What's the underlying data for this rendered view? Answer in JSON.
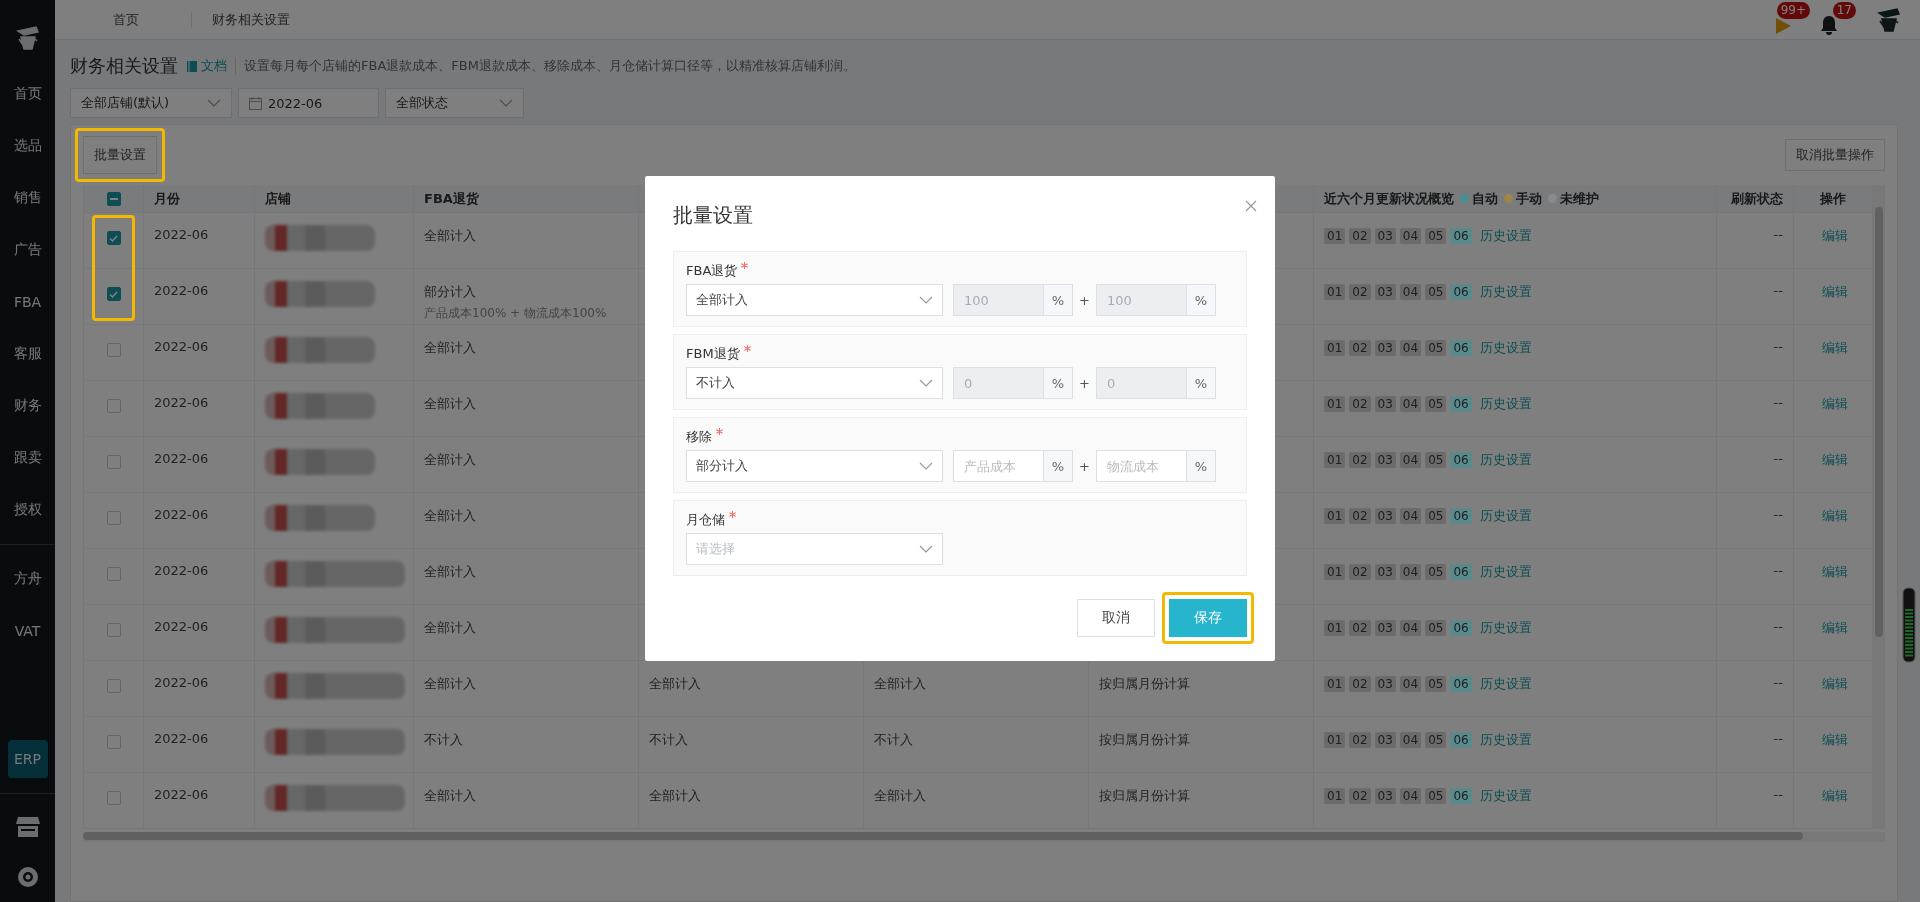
{
  "sidebar": {
    "items": [
      {
        "kind": "text",
        "label": "首页",
        "selected": false
      },
      {
        "kind": "text",
        "label": "选品",
        "selected": false
      },
      {
        "kind": "text",
        "label": "销售",
        "selected": false
      },
      {
        "kind": "text",
        "label": "广告",
        "selected": false
      },
      {
        "kind": "text",
        "label": "FBA",
        "selected": false
      },
      {
        "kind": "text",
        "label": "客服",
        "selected": false
      },
      {
        "kind": "text",
        "label": "财务",
        "selected": false
      },
      {
        "kind": "text",
        "label": "跟卖",
        "selected": false
      },
      {
        "kind": "text",
        "label": "授权",
        "selected": false
      },
      {
        "kind": "divider"
      },
      {
        "kind": "text",
        "label": "方舟",
        "selected": false
      },
      {
        "kind": "text",
        "label": "VAT",
        "selected": false
      },
      {
        "kind": "spacer"
      },
      {
        "kind": "text",
        "label": "ERP",
        "selected": true
      },
      {
        "kind": "divider"
      },
      {
        "kind": "store"
      },
      {
        "kind": "support"
      }
    ]
  },
  "topbar": {
    "tabs": [
      "首页",
      "财务相关设置"
    ],
    "notifications": [
      {
        "kind": "flag",
        "badge": "99+"
      },
      {
        "kind": "bell",
        "badge": "17"
      }
    ]
  },
  "page": {
    "title": "财务相关设置",
    "doc_link": "文档",
    "description": "设置每月每个店铺的FBA退款成本、FBM退款成本、移除成本、月仓储计算口径等，以精准核算店铺利润。"
  },
  "filters": [
    {
      "kind": "select",
      "value": "全部店铺(默认)"
    },
    {
      "kind": "date",
      "value": "2022-06"
    },
    {
      "kind": "select",
      "value": "全部状态"
    }
  ],
  "toolbar": {
    "batch_button": {
      "label": "批量设置",
      "highlighted": true
    },
    "cancel_batch_button": "取消批量操作"
  },
  "table": {
    "header_checkbox": {
      "indeterminate": true
    },
    "columns": {
      "month": "月份",
      "store": "店铺",
      "fba": "FBA退货",
      "overview": "近六个月更新状况概览",
      "refresh": "刷新状态",
      "action": "操作"
    },
    "legend": [
      {
        "label": "自动",
        "color": "#4a8e90"
      },
      {
        "label": "手动",
        "color": "#a08448"
      },
      {
        "label": "未维护",
        "color": "#8a8a8a"
      }
    ],
    "rows": [
      {
        "checked": true,
        "highlighted": true,
        "month": "2022-06",
        "fba": "全部计入",
        "months": [
          {
            "label": "01",
            "color": "#6b6b6b"
          },
          {
            "label": "02",
            "color": "#6b6b6b"
          },
          {
            "label": "03",
            "color": "#6b6b6b"
          },
          {
            "label": "04",
            "color": "#6b6b6b"
          },
          {
            "label": "05",
            "color": "#6b6b6b"
          },
          {
            "label": "06",
            "color": "#5a8a8c"
          }
        ],
        "history": "历史设置",
        "refresh": "--",
        "action": "编辑"
      },
      {
        "checked": true,
        "highlighted": true,
        "month": "2022-06",
        "fba": "部分计入",
        "fba_note": "产品成本100% + 物流成本100%",
        "months": [
          {
            "label": "01",
            "color": "#6b6b6b"
          },
          {
            "label": "02",
            "color": "#6b6b6b"
          },
          {
            "label": "03",
            "color": "#6b6b6b"
          },
          {
            "label": "04",
            "color": "#6b6b6b"
          },
          {
            "label": "05",
            "color": "#6b6b6b"
          },
          {
            "label": "06",
            "color": "#5a8a8c"
          }
        ],
        "history": "历史设置",
        "refresh": "--",
        "action": "编辑"
      },
      {
        "checked": false,
        "highlighted": false,
        "month": "2022-06",
        "fba": "全部计入",
        "months": [
          {
            "label": "01",
            "color": "#6b6b6b"
          },
          {
            "label": "02",
            "color": "#6b6b6b"
          },
          {
            "label": "03",
            "color": "#6b6b6b"
          },
          {
            "label": "04",
            "color": "#6b6b6b"
          },
          {
            "label": "05",
            "color": "#6b6b6b"
          },
          {
            "label": "06",
            "color": "#5a8a8c"
          }
        ],
        "history": "历史设置",
        "refresh": "--",
        "action": "编辑"
      },
      {
        "checked": false,
        "highlighted": false,
        "month": "2022-06",
        "fba": "全部计入",
        "months": [
          {
            "label": "01",
            "color": "#6b6b6b"
          },
          {
            "label": "02",
            "color": "#6b6b6b"
          },
          {
            "label": "03",
            "color": "#6b6b6b"
          },
          {
            "label": "04",
            "color": "#6b6b6b"
          },
          {
            "label": "05",
            "color": "#6b6b6b"
          },
          {
            "label": "06",
            "color": "#5a8a8c"
          }
        ],
        "history": "历史设置",
        "refresh": "--",
        "action": "编辑"
      },
      {
        "checked": false,
        "highlighted": false,
        "month": "2022-06",
        "fba": "全部计入",
        "months": [
          {
            "label": "01",
            "color": "#6b6b6b"
          },
          {
            "label": "02",
            "color": "#6b6b6b"
          },
          {
            "label": "03",
            "color": "#6b6b6b"
          },
          {
            "label": "04",
            "color": "#6b6b6b"
          },
          {
            "label": "05",
            "color": "#6b6b6b"
          },
          {
            "label": "06",
            "color": "#5a8a8c"
          }
        ],
        "history": "历史设置",
        "refresh": "--",
        "action": "编辑"
      },
      {
        "checked": false,
        "highlighted": false,
        "month": "2022-06",
        "fba": "全部计入",
        "months": [
          {
            "label": "01",
            "color": "#6b6b6b"
          },
          {
            "label": "02",
            "color": "#6b6b6b"
          },
          {
            "label": "03",
            "color": "#6b6b6b"
          },
          {
            "label": "04",
            "color": "#6b6b6b"
          },
          {
            "label": "05",
            "color": "#6b6b6b"
          },
          {
            "label": "06",
            "color": "#5a8a8c"
          }
        ],
        "history": "历史设置",
        "refresh": "--",
        "action": "编辑"
      },
      {
        "checked": false,
        "highlighted": false,
        "month": "2022-06",
        "fba": "全部计入",
        "months": [
          {
            "label": "01",
            "color": "#6b6b6b"
          },
          {
            "label": "02",
            "color": "#6b6b6b"
          },
          {
            "label": "03",
            "color": "#6b6b6b"
          },
          {
            "label": "04",
            "color": "#6b6b6b"
          },
          {
            "label": "05",
            "color": "#6b6b6b"
          },
          {
            "label": "06",
            "color": "#5a8a8c"
          }
        ],
        "history": "历史设置",
        "refresh": "--",
        "action": "编辑"
      },
      {
        "checked": false,
        "highlighted": false,
        "month": "2022-06",
        "fba": "全部计入",
        "months": [
          {
            "label": "01",
            "color": "#6b6b6b"
          },
          {
            "label": "02",
            "color": "#6b6b6b"
          },
          {
            "label": "03",
            "color": "#6b6b6b"
          },
          {
            "label": "04",
            "color": "#6b6b6b"
          },
          {
            "label": "05",
            "color": "#6b6b6b"
          },
          {
            "label": "06",
            "color": "#5a8a8c"
          }
        ],
        "history": "历史设置",
        "refresh": "--",
        "action": "编辑"
      },
      {
        "checked": false,
        "highlighted": false,
        "month": "2022-06",
        "fba": "全部计入",
        "column_5": "全部计入",
        "column_6": "全部计入",
        "column_7": "按归属月份计算",
        "months": [
          {
            "label": "01",
            "color": "#6b6b6b"
          },
          {
            "label": "02",
            "color": "#6b6b6b"
          },
          {
            "label": "03",
            "color": "#6b6b6b"
          },
          {
            "label": "04",
            "color": "#6b6b6b"
          },
          {
            "label": "05",
            "color": "#6b6b6b"
          },
          {
            "label": "06",
            "color": "#5a8a8c"
          }
        ],
        "history": "历史设置",
        "refresh": "--",
        "action": "编辑"
      },
      {
        "checked": false,
        "highlighted": false,
        "month": "2022-06",
        "fba": "不计入",
        "column_5": "不计入",
        "column_6": "不计入",
        "column_7": "按归属月份计算",
        "months": [
          {
            "label": "01",
            "color": "#6b6b6b"
          },
          {
            "label": "02",
            "color": "#6b6b6b"
          },
          {
            "label": "03",
            "color": "#6b6b6b"
          },
          {
            "label": "04",
            "color": "#6b6b6b"
          },
          {
            "label": "05",
            "color": "#6b6b6b"
          },
          {
            "label": "06",
            "color": "#5a8a8c"
          }
        ],
        "history": "历史设置",
        "refresh": "--",
        "action": "编辑"
      },
      {
        "checked": false,
        "highlighted": false,
        "month": "2022-06",
        "fba": "全部计入",
        "column_5": "全部计入",
        "column_6": "全部计入",
        "column_7": "按归属月份计算",
        "months": [
          {
            "label": "01",
            "color": "#6b6b6b"
          },
          {
            "label": "02",
            "color": "#6b6b6b"
          },
          {
            "label": "03",
            "color": "#6b6b6b"
          },
          {
            "label": "04",
            "color": "#6b6b6b"
          },
          {
            "label": "05",
            "color": "#6b6b6b"
          },
          {
            "label": "06",
            "color": "#5a8a8c"
          }
        ],
        "history": "历史设置",
        "refresh": "--",
        "action": "编辑"
      }
    ]
  },
  "modal": {
    "title": "批量设置",
    "sections": [
      {
        "label": "FBA退货",
        "required": true,
        "select": {
          "value": "全部计入"
        },
        "joiner": "+",
        "inputs": [
          {
            "value": "100",
            "disabled": true,
            "unit": "%"
          },
          {
            "value": "100",
            "disabled": true,
            "unit": "%"
          }
        ]
      },
      {
        "label": "FBM退货",
        "required": true,
        "select": {
          "value": "不计入"
        },
        "joiner": "+",
        "inputs": [
          {
            "value": "0",
            "disabled": true,
            "unit": "%"
          },
          {
            "value": "0",
            "disabled": true,
            "unit": "%"
          }
        ]
      },
      {
        "label": "移除",
        "required": true,
        "select": {
          "value": "部分计入"
        },
        "joiner": "+",
        "inputs": [
          {
            "placeholder": "产品成本",
            "disabled": false,
            "unit": "%"
          },
          {
            "placeholder": "物流成本",
            "disabled": false,
            "unit": "%"
          }
        ]
      },
      {
        "label": "月仓储",
        "required": true,
        "select": {
          "placeholder": "请选择"
        }
      }
    ],
    "buttons": [
      {
        "label": "取消",
        "kind": "default",
        "highlighted": false
      },
      {
        "label": "保存",
        "kind": "primary",
        "highlighted": true
      }
    ]
  }
}
